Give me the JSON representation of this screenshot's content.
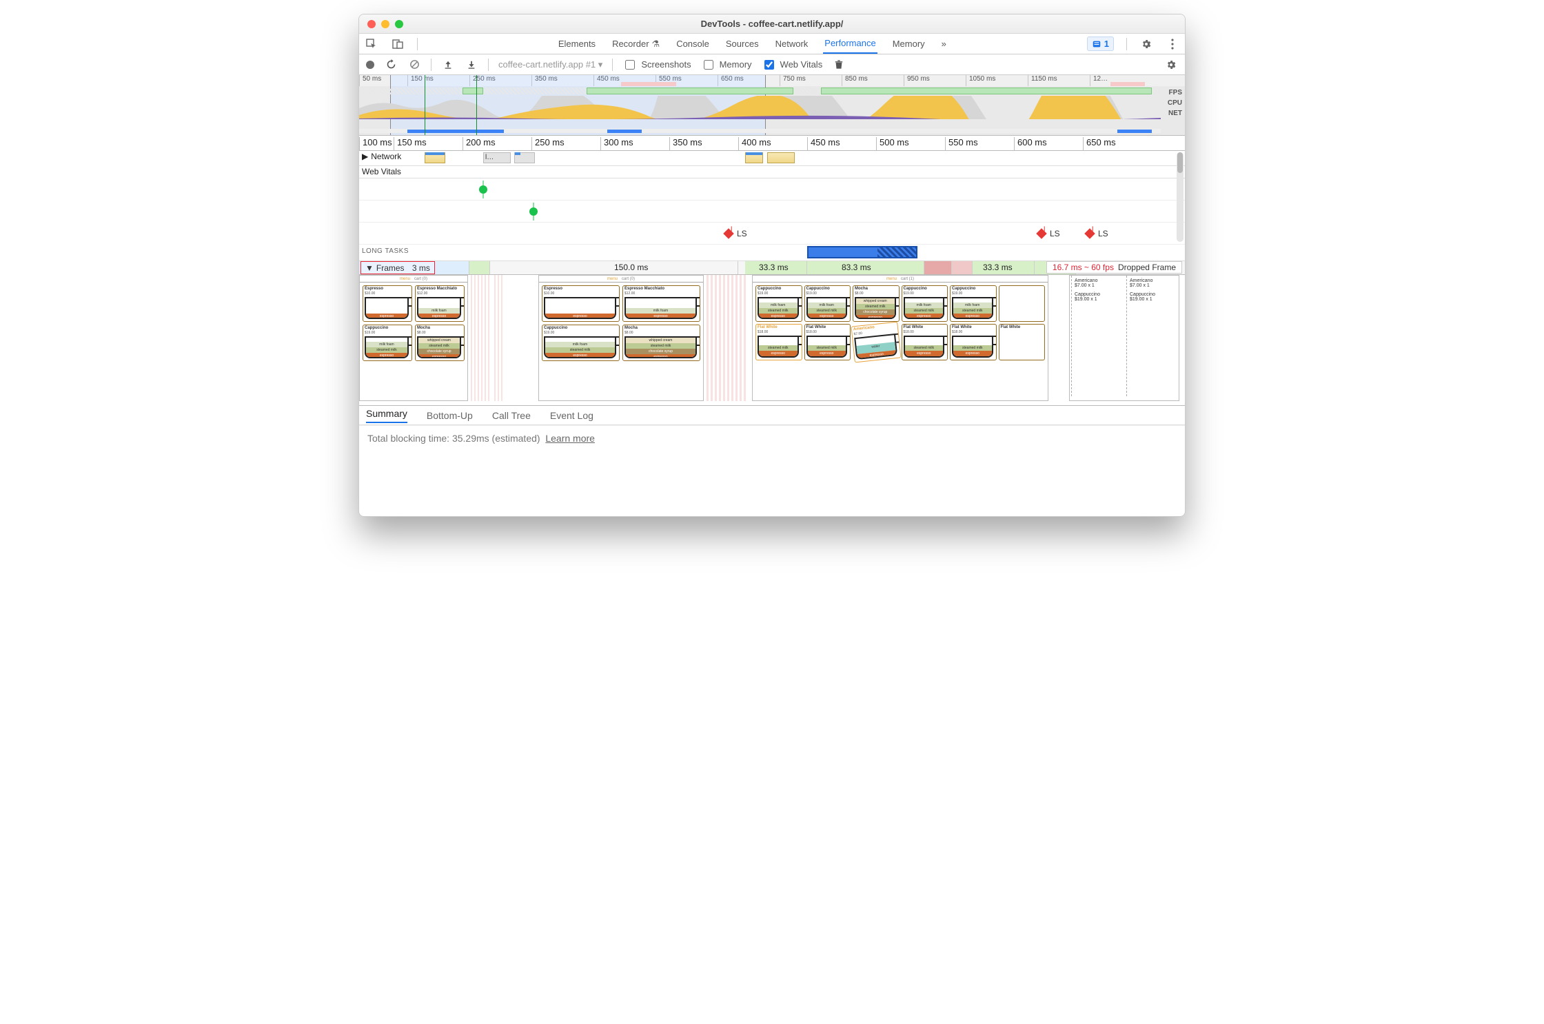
{
  "window_title": "DevTools - coffee-cart.netlify.app/",
  "main_tabs": {
    "elements": "Elements",
    "recorder": "Recorder",
    "console": "Console",
    "sources": "Sources",
    "network": "Network",
    "performance": "Performance",
    "memory": "Memory"
  },
  "issues_count": "1",
  "perf_toolbar": {
    "recording_label": "coffee-cart.netlify.app #1",
    "screenshots": "Screenshots",
    "memory": "Memory",
    "webvitals": "Web Vitals"
  },
  "overview_ticks": [
    "50 ms",
    "150 ms",
    "250 ms",
    "350 ms",
    "450 ms",
    "550 ms",
    "650 ms",
    "750 ms",
    "850 ms",
    "950 ms",
    "1050 ms",
    "1150 ms",
    "12…"
  ],
  "overview_lane_labels": {
    "fps": "FPS",
    "cpu": "CPU",
    "net": "NET"
  },
  "ruler_ticks": [
    "100 ms",
    "150 ms",
    "200 ms",
    "250 ms",
    "300 ms",
    "350 ms",
    "400 ms",
    "450 ms",
    "500 ms",
    "550 ms",
    "600 ms",
    "650 ms"
  ],
  "tracks": {
    "network_label": "Network",
    "network_trunc": "l…",
    "webvitals_label": "Web Vitals",
    "longtasks_label": "LONG TASKS",
    "frames_label": "Frames",
    "ls": "LS"
  },
  "frame_times": {
    "f0": "3 ms",
    "f1": "150.0 ms",
    "f2": "33.3 ms",
    "f3": "83.3 ms",
    "f4": "33.3 ms"
  },
  "tooltip": {
    "metric": "16.7 ms ~ 60 fps",
    "label": "Dropped Frame"
  },
  "detail_tabs": {
    "summary": "Summary",
    "bottomup": "Bottom-Up",
    "calltree": "Call Tree",
    "eventlog": "Event Log"
  },
  "summary": {
    "text": "Total blocking time: 35.29ms (estimated)",
    "learn": "Learn more"
  },
  "drinks": {
    "espresso": {
      "name": "Espresso",
      "price": "$10.00"
    },
    "macchiato": {
      "name": "Espresso Macchiato",
      "price": "$12.00"
    },
    "cappuccino": {
      "name": "Cappuccino",
      "price": "$19.00"
    },
    "mocha": {
      "name": "Mocha",
      "price": "$8.00"
    },
    "flatwhite": {
      "name": "Flat White",
      "price": "$18.00"
    },
    "americano": {
      "name": "Americano",
      "price": "$7.00"
    }
  },
  "layers": {
    "milkfoam": "milk foam",
    "steamed": "steamed milk",
    "syrup": "chocolate syrup",
    "espresso": "espresso",
    "water": "water",
    "cream": "whipped cream"
  },
  "menu_hdr": {
    "menu": "menu",
    "cart0": "cart (0)",
    "cart1": "cart (1)"
  },
  "cart": {
    "a": "Americano",
    "ap": "$7.00 x 1",
    "c": "Cappuccino",
    "cp": "$19.00 x 1"
  }
}
